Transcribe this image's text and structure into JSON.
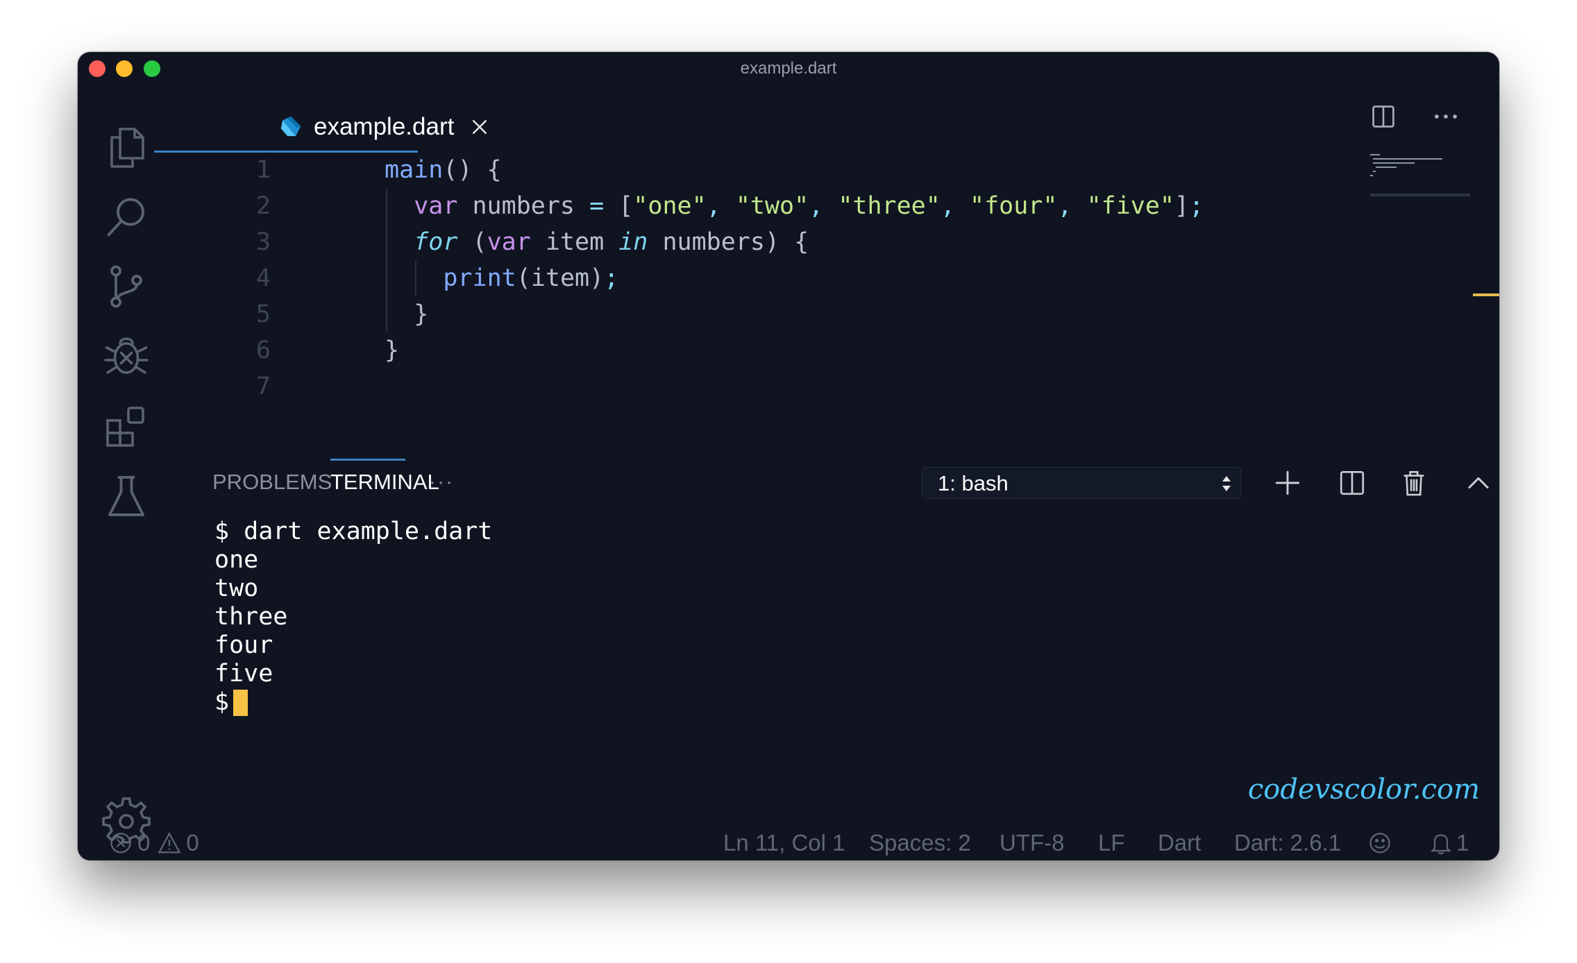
{
  "window": {
    "title": "example.dart"
  },
  "tab": {
    "label": "example.dart"
  },
  "editor": {
    "lines": [
      {
        "n": "1",
        "indent": 0,
        "tokens": [
          {
            "t": "main",
            "c": "fn"
          },
          {
            "t": "() {",
            "c": "plain"
          }
        ]
      },
      {
        "n": "2",
        "indent": 1,
        "tokens": [
          {
            "t": "var",
            "c": "kw"
          },
          {
            "t": " numbers ",
            "c": "plain"
          },
          {
            "t": "=",
            "c": "punc"
          },
          {
            "t": " [",
            "c": "plain"
          },
          {
            "t": "\"one\"",
            "c": "str"
          },
          {
            "t": ", ",
            "c": "punc"
          },
          {
            "t": "\"two\"",
            "c": "str"
          },
          {
            "t": ", ",
            "c": "punc"
          },
          {
            "t": "\"three\"",
            "c": "str"
          },
          {
            "t": ", ",
            "c": "punc"
          },
          {
            "t": "\"four\"",
            "c": "str"
          },
          {
            "t": ", ",
            "c": "punc"
          },
          {
            "t": "\"five\"",
            "c": "str"
          },
          {
            "t": "]",
            "c": "plain"
          },
          {
            "t": ";",
            "c": "punc"
          }
        ]
      },
      {
        "n": "3",
        "indent": 1,
        "tokens": [
          {
            "t": "for",
            "c": "kw-it"
          },
          {
            "t": " (",
            "c": "plain"
          },
          {
            "t": "var",
            "c": "kw"
          },
          {
            "t": " item ",
            "c": "plain"
          },
          {
            "t": "in",
            "c": "kw-it"
          },
          {
            "t": " numbers) {",
            "c": "plain"
          }
        ]
      },
      {
        "n": "4",
        "indent": 2,
        "tokens": [
          {
            "t": "print",
            "c": "fn"
          },
          {
            "t": "(item)",
            "c": "plain"
          },
          {
            "t": ";",
            "c": "punc"
          }
        ]
      },
      {
        "n": "5",
        "indent": 1,
        "tokens": [
          {
            "t": "}",
            "c": "plain"
          }
        ]
      },
      {
        "n": "6",
        "indent": 0,
        "tokens": [
          {
            "t": "}",
            "c": "plain"
          }
        ]
      },
      {
        "n": "7",
        "indent": 0,
        "tokens": []
      }
    ]
  },
  "panel": {
    "tabs": [
      "PROBLEMS",
      "TERMINAL"
    ],
    "more": "···",
    "terminal_select": "1: bash"
  },
  "terminal": {
    "lines": [
      "$ dart example.dart",
      "one",
      "two",
      "three",
      "four",
      "five"
    ],
    "prompt": "$"
  },
  "watermark": "codevscolor.com",
  "status": {
    "errors": "0",
    "warnings": "0",
    "position": "Ln 11, Col 1",
    "spaces": "Spaces: 2",
    "encoding": "UTF-8",
    "eol": "LF",
    "language": "Dart",
    "sdk": "Dart: 2.6.1",
    "notifications": "1"
  },
  "colors": {
    "background": "#0f1420",
    "accent": "#3b82c4",
    "cursor": "#f5c245",
    "string": "#c3e88d",
    "keyword": "#c791ea"
  }
}
